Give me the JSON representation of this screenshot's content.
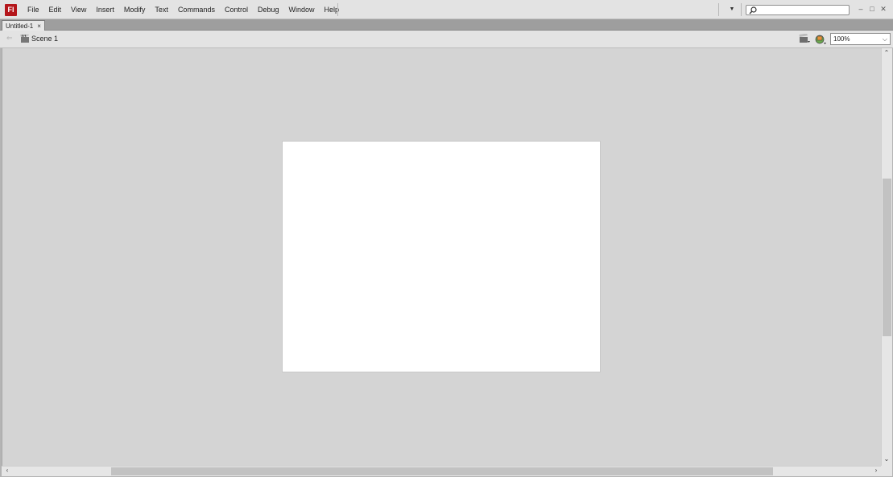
{
  "app": {
    "logo_text": "Fl"
  },
  "menu": [
    "File",
    "Edit",
    "View",
    "Insert",
    "Modify",
    "Text",
    "Commands",
    "Control",
    "Debug",
    "Window",
    "Help"
  ],
  "search": {
    "placeholder": "",
    "value": ""
  },
  "window_controls": {
    "minimize": "–",
    "maximize": "□",
    "close": "✕"
  },
  "document_tab": {
    "title": "Untitled-1",
    "close": "×"
  },
  "edit_bar": {
    "scene_label": "Scene 1",
    "zoom": "100%"
  },
  "icons": {
    "workspace_dropdown": "chevron-down-icon",
    "search": "search-icon",
    "scene": "scene-clapper-icon",
    "edit_scene": "edit-scene-icon",
    "edit_symbols": "edit-symbols-icon"
  },
  "colors": {
    "stage": "#ffffff",
    "pasteboard": "#d4d4d4",
    "logo": "#b4161b"
  }
}
